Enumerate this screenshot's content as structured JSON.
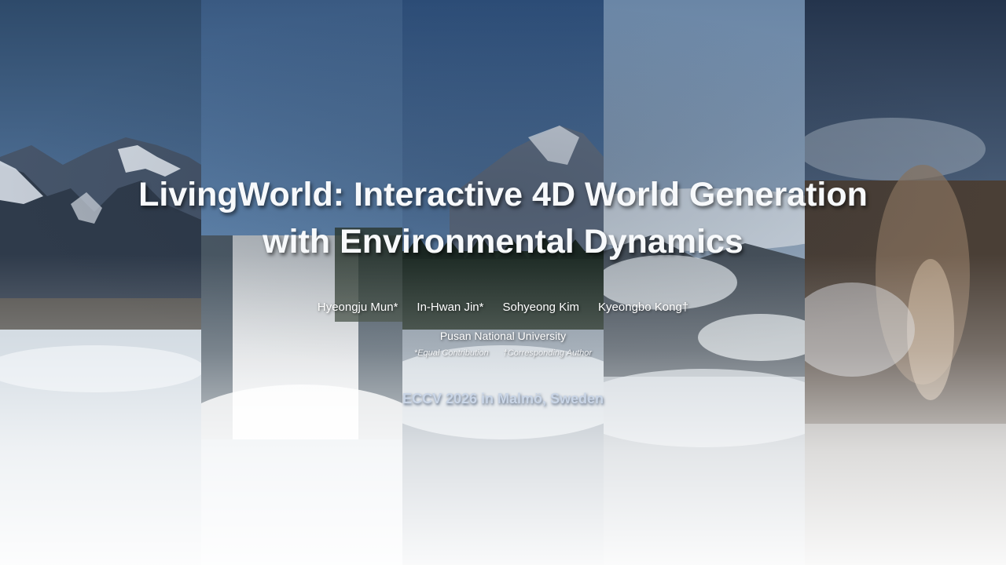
{
  "paper": {
    "title_line1": "LivingWorld: Interactive 4D World Generation",
    "title_line2": "with Environmental Dynamics",
    "authors": [
      "Hyeongju Mun*",
      "In-Hwan Jin*",
      "Sohyeong Kim",
      "Kyeongbo Kong†"
    ],
    "affiliation": "Pusan National University",
    "notes": {
      "equal": "*Equal Contribution",
      "corresponding": "†Corresponding Author"
    },
    "venue": "ECCV 2026 in Malmö, Sweden"
  },
  "colors": {
    "sky": "#3c5878",
    "title": "#f7f9fb",
    "venue": "#c9d5e6"
  }
}
